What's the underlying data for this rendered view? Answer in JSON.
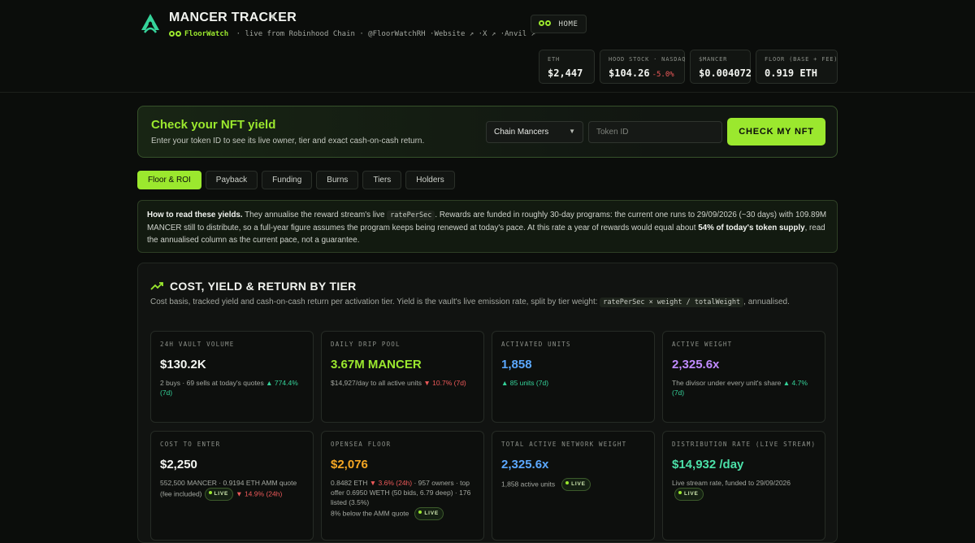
{
  "header": {
    "brand": "MANCER TRACKER",
    "handle": "FloorWatch",
    "subline": "· live from Robinhood Chain · @FloorWatchRH ·Website ↗ ·X ↗ ·Anvil ↗",
    "home_label": "HOME"
  },
  "stats": [
    {
      "label": "ETH",
      "value": "$2,447",
      "change": ""
    },
    {
      "label": "HOOD STOCK · NASDAQ",
      "value": "$104.26",
      "change": "-5.0%"
    },
    {
      "label": "$MANCER",
      "value": "$0.004072",
      "change": ""
    },
    {
      "label": "FLOOR (BASE + FEE)",
      "value": "0.919 ETH",
      "change": ""
    }
  ],
  "checker": {
    "title": "Check your NFT yield",
    "subtitle": "Enter your token ID to see its live owner, tier and exact cash-on-cash return.",
    "collection": "Chain Mancers",
    "token_placeholder": "Token ID",
    "button": "CHECK MY NFT"
  },
  "tabs": [
    "Floor & ROI",
    "Payback",
    "Funding",
    "Burns",
    "Tiers",
    "Holders"
  ],
  "note": {
    "lead": "How to read these yields.",
    "t1": " They annualise the reward stream's live ",
    "code": "ratePerSec",
    "t2": ". Rewards are funded in roughly 30-day programs: the current one runs to 29/09/2026 (~30 days) with 109.89M MANCER still to distribute, so a full-year figure assumes the program keeps being renewed at today's pace. At this rate a year of rewards would equal about ",
    "bold2": "54% of today's token supply",
    "t3": ", read the annualised column as the current pace, not a guarantee."
  },
  "panel": {
    "title": "COST, YIELD & RETURN BY TIER",
    "desc_a": "Cost basis, tracked yield and cash-on-cash return per activation tier. Yield is the vault's live emission rate, split by tier weight: ",
    "formula": "ratePerSec × weight / totalWeight",
    "desc_b": ", annualised."
  },
  "live_label": "LIVE",
  "cards": {
    "vol": {
      "label": "24H VAULT VOLUME",
      "value": "$130.2K",
      "sub": "2 buys · 69 sells at today's quotes",
      "delta": "▲ 774.4%",
      "period": "(7d)"
    },
    "drip": {
      "label": "DAILY DRIP POOL",
      "value": "3.67M MANCER",
      "sub": "$14,927/day to all active units",
      "delta": "▼ 10.7%",
      "period": "(7d)"
    },
    "units": {
      "label": "ACTIVATED UNITS",
      "value": "1,858",
      "delta": "▲ 85 units",
      "period": "(7d)"
    },
    "weight": {
      "label": "ACTIVE WEIGHT",
      "value": "2,325.6x",
      "sub": "The divisor under every unit's share",
      "delta": "▲ 4.7%",
      "period": "(7d)"
    },
    "cost": {
      "label": "COST TO ENTER",
      "value": "$2,250",
      "sub": "552,500 MANCER · 0.9194 ETH AMM quote (fee included)",
      "delta": "▼ 14.9%",
      "period": "(24h)"
    },
    "floor": {
      "label": "OPENSEA FLOOR",
      "value": "$2,076",
      "sub_a": "0.8482 ETH",
      "delta": "▼ 3.6% (24h)",
      "sub_b": "· 957 owners · top offer 0.6950 WETH (50 bids, 6.79 deep) · 176 listed (3.5%)",
      "sub_c": "8% below the AMM quote"
    },
    "network": {
      "label": "TOTAL ACTIVE NETWORK WEIGHT",
      "value": "2,325.6x",
      "sub": "1,858 active units"
    },
    "rate": {
      "label": "DISTRIBUTION RATE (LIVE STREAM)",
      "value": "$14,932 /day",
      "sub": "Live stream rate, funded to 29/09/2026"
    }
  },
  "colors": {
    "accent": "#9be82e",
    "down": "#ef5a5a",
    "up": "#35d39a",
    "background": "#0b0d0b"
  }
}
